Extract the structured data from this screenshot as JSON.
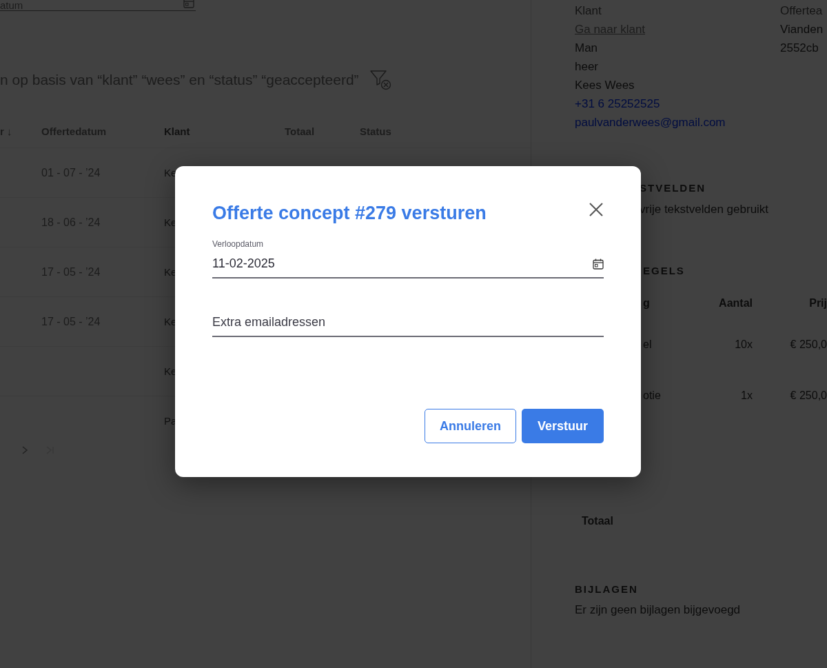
{
  "top_field": {
    "value": "atum"
  },
  "filter": {
    "text": "n op basis van “klant” “wees” en “status” “geaccepteerd”"
  },
  "table": {
    "columns": [
      "r ↓",
      "Offertedatum",
      "Klant",
      "Totaal",
      "Status"
    ],
    "rows": [
      {
        "date": "01 - 07 - ’24",
        "klant": "Ke"
      },
      {
        "date": "18 - 06 - ’24",
        "klant": "Ke"
      },
      {
        "date": "17 - 05 - ’24",
        "klant": "Ke"
      },
      {
        "date": "17 - 05 - ’24",
        "klant": "Ke"
      },
      {
        "date": "",
        "klant": "Ke"
      },
      {
        "date": "",
        "klant": "Pa"
      }
    ]
  },
  "customer": {
    "label": "Klant",
    "link": "Ga naar klant",
    "lines": [
      "Man",
      "heer",
      "Kees Wees"
    ],
    "phone": "+31 6 25252525",
    "email": "paulvanderwees@gmail.com"
  },
  "offer_address": {
    "label": "Offertea",
    "lines": [
      "Vianden",
      "2552cb"
    ]
  },
  "text_fields": {
    "heading": "STVELDEN",
    "text": "vrije tekstvelden gebruikt"
  },
  "lines": {
    "heading": "EGELS",
    "columns": [
      "g",
      "Aantal",
      "Prij"
    ],
    "rows": [
      [
        "el",
        "10x",
        "€ 250,0"
      ],
      [
        "otie",
        "1x",
        "€ 250,0"
      ]
    ],
    "total_label": "Totaal"
  },
  "attachments": {
    "heading": "BIJLAGEN",
    "text": "Er zijn geen bijlagen bijgevoegd"
  },
  "dialog": {
    "title": "Offerte concept #279 versturen",
    "fields": [
      {
        "kind": "date",
        "label": "Verloopdatum",
        "value": "11-02-2025"
      },
      {
        "kind": "text",
        "placeholder": "Extra emailadressen"
      }
    ],
    "buttons": [
      {
        "kind": "secondary",
        "label": "Annuleren"
      },
      {
        "kind": "primary",
        "label": "Verstuur"
      }
    ]
  }
}
